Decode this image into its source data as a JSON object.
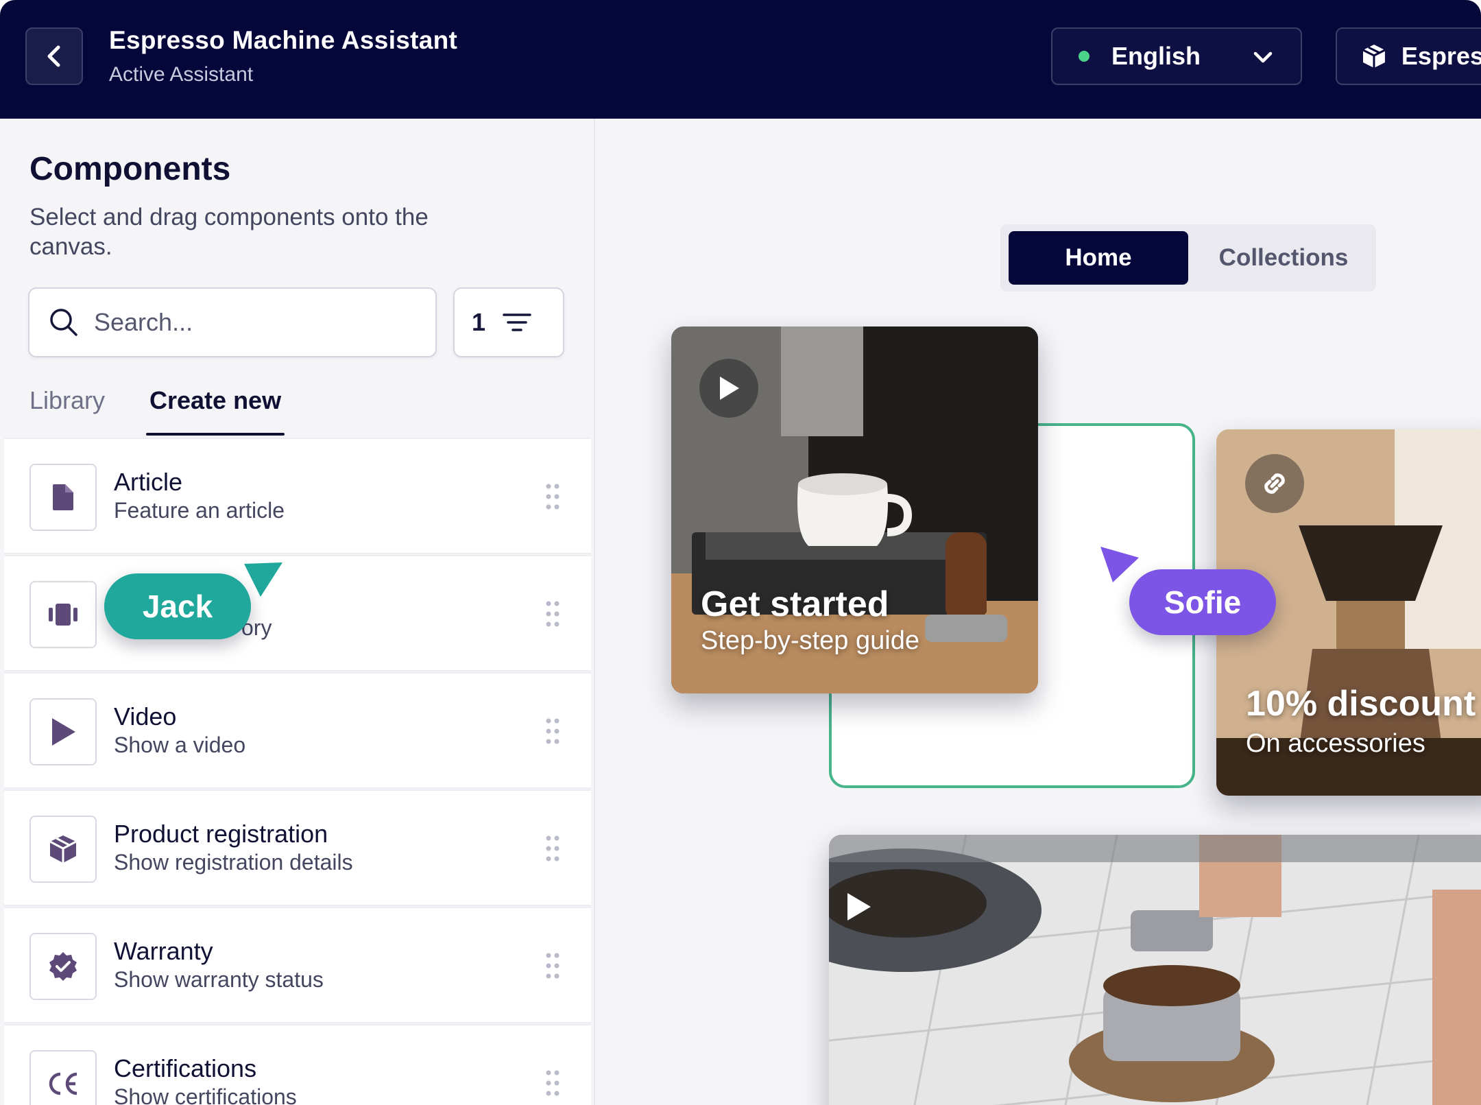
{
  "header": {
    "title": "Espresso Machine Assistant",
    "subtitle": "Active Assistant",
    "language": "English",
    "product": "Espresso"
  },
  "sidebar": {
    "title": "Components",
    "description": "Select and drag components onto the canvas.",
    "search_placeholder": "Search...",
    "filter_count": "1",
    "tabs": [
      {
        "label": "Library",
        "active": false
      },
      {
        "label": "Create new",
        "active": true
      }
    ],
    "components": [
      {
        "name": "Article",
        "desc": "Feature an article",
        "icon": "document-icon"
      },
      {
        "name": "",
        "desc": "ory",
        "icon": "carousel-icon"
      },
      {
        "name": "Video",
        "desc": "Show a video",
        "icon": "play-icon"
      },
      {
        "name": "Product registration",
        "desc": "Show registration details",
        "icon": "box-icon"
      },
      {
        "name": "Warranty",
        "desc": "Show warranty status",
        "icon": "badge-check-icon"
      },
      {
        "name": "Certifications",
        "desc": "Show certifications",
        "icon": "ce-mark-icon"
      }
    ]
  },
  "canvas": {
    "nav": {
      "home": "Home",
      "collections": "Collections",
      "active": "Home"
    },
    "cards": [
      {
        "title": "Get started",
        "subtitle": "Step-by-step guide",
        "icon": "play-icon"
      },
      {
        "title": "10% discount",
        "subtitle": "On accessories",
        "icon": "link-icon"
      },
      {
        "title": "",
        "subtitle": "",
        "icon": "play-icon"
      }
    ]
  },
  "collaborators": [
    {
      "name": "Jack",
      "color": "#1fa89b"
    },
    {
      "name": "Sofie",
      "color": "#7d55e6"
    }
  ],
  "colors": {
    "header_bg": "#050639",
    "accent_green": "#47b48a",
    "status_dot": "#4cd38a"
  }
}
